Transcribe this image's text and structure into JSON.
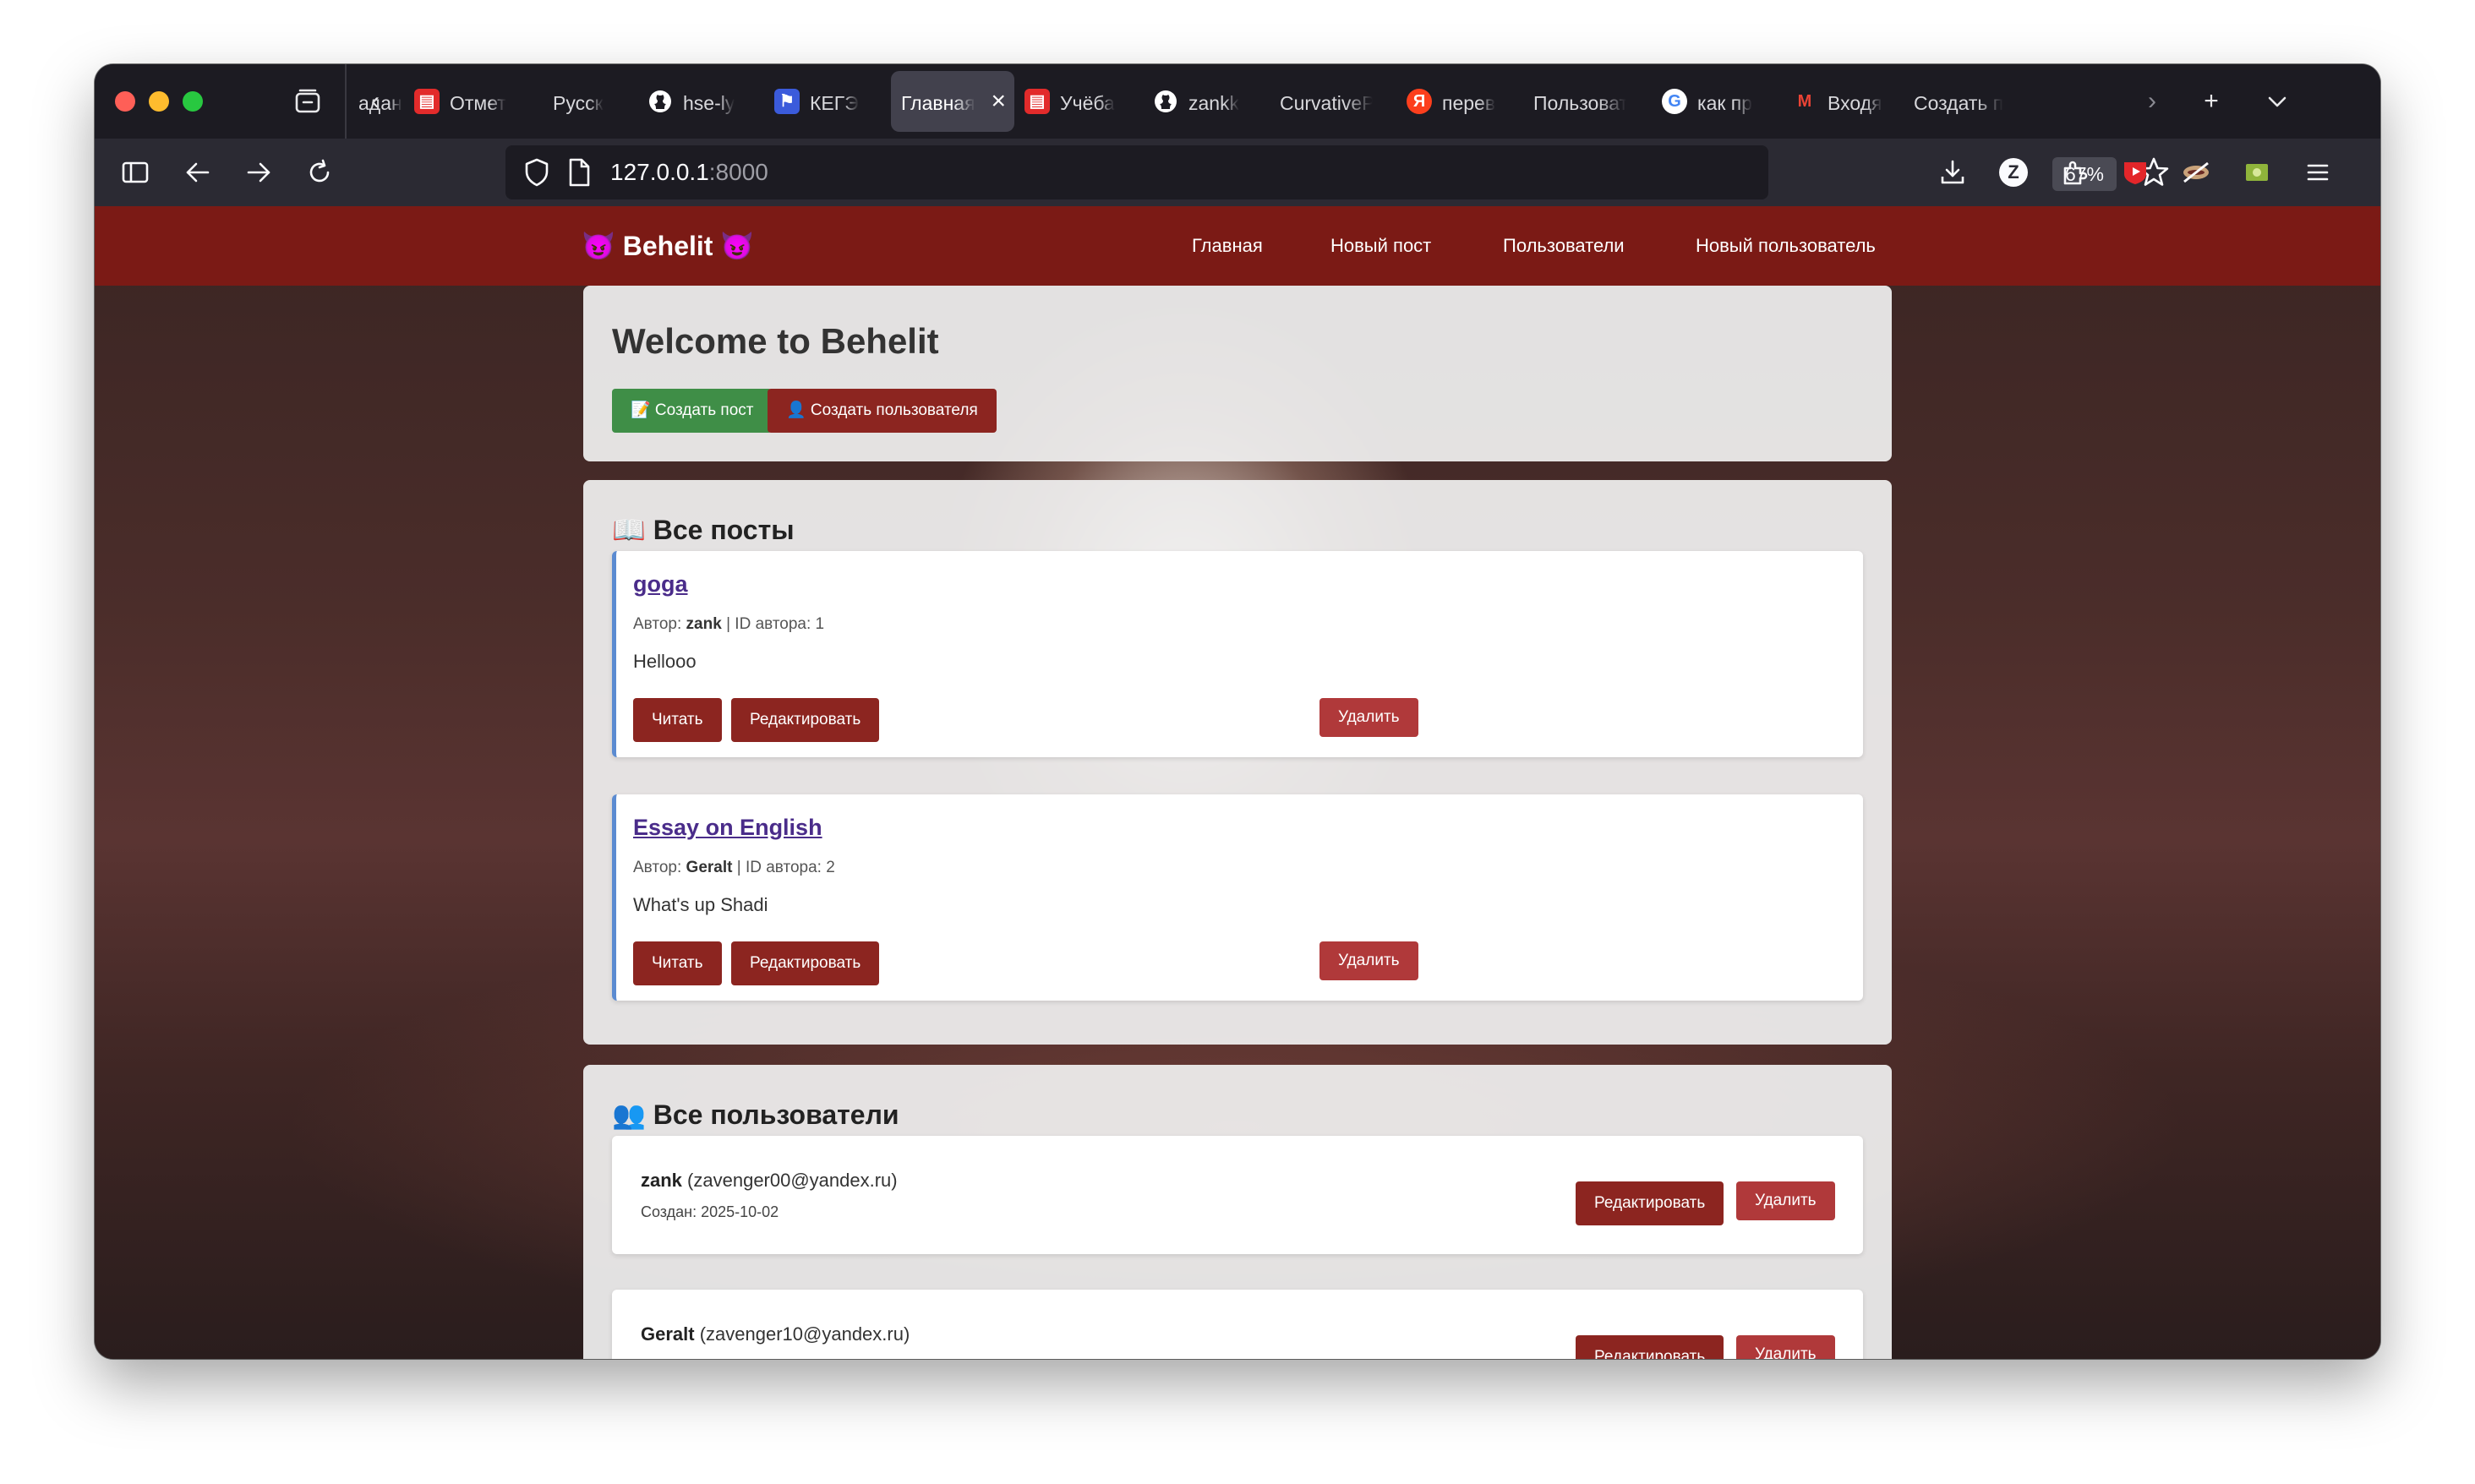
{
  "browser": {
    "tabs": [
      {
        "label": "адан",
        "favicon": "",
        "favicon_color": ""
      },
      {
        "label": "Отмет",
        "favicon": "doc-icon",
        "favicon_color": "#e22b2b"
      },
      {
        "label": "Русск",
        "favicon": "",
        "favicon_color": ""
      },
      {
        "label": "hse-ly",
        "favicon": "github-icon",
        "favicon_color": "#ffffff"
      },
      {
        "label": "КЕГЭ",
        "favicon": "kege-icon",
        "favicon_color": "#3b5bdb"
      },
      {
        "label": "Главная",
        "favicon": "",
        "favicon_color": "",
        "active": true
      },
      {
        "label": "Учёба",
        "favicon": "doc-icon",
        "favicon_color": "#e22b2b"
      },
      {
        "label": "zankk",
        "favicon": "github-icon",
        "favicon_color": "#ffffff"
      },
      {
        "label": "CurvativeP",
        "favicon": "",
        "favicon_color": ""
      },
      {
        "label": "перев",
        "favicon": "yandex-icon",
        "favicon_color": "#fc3f1d"
      },
      {
        "label": "Пользоват",
        "favicon": "",
        "favicon_color": ""
      },
      {
        "label": "как пр",
        "favicon": "google-icon",
        "favicon_color": "#4285f4"
      },
      {
        "label": "Входя",
        "favicon": "gmail-icon",
        "favicon_color": "#ea4335"
      },
      {
        "label": "Создать п",
        "favicon": "",
        "favicon_color": ""
      }
    ],
    "url_host": "127.0.0.1",
    "url_port": ":8000",
    "zoom": "67%"
  },
  "nav": {
    "brand": "😈 Behelit 😈",
    "links": [
      "Главная",
      "Новый пост",
      "Пользователи",
      "Новый пользователь"
    ]
  },
  "welcome": {
    "title": "Welcome to Behelit",
    "create_post": "📝 Создать пост",
    "create_user": "👤 Создать пользователя"
  },
  "posts_section": {
    "heading": "📖 Все посты",
    "posts": [
      {
        "title": "goga",
        "author_label": "Автор:",
        "author": "zank",
        "author_id_label": "| ID автора: 1",
        "body": "Hellooo"
      },
      {
        "title": "Essay on English",
        "author_label": "Автор:",
        "author": "Geralt",
        "author_id_label": "| ID автора: 2",
        "body": "What's up Shadi"
      }
    ],
    "read_label": "Читать",
    "edit_label": "Редактировать",
    "delete_label": "Удалить"
  },
  "users_section": {
    "heading": "👥 Все пользователи",
    "users": [
      {
        "name": "zank",
        "email": "(zavenger00@yandex.ru)",
        "created": "Создан: 2025-10-02"
      },
      {
        "name": "Geralt",
        "email": "(zavenger10@yandex.ru)",
        "created": ""
      }
    ],
    "edit_label": "Редактировать",
    "delete_label": "Удалить"
  },
  "colors": {
    "navbar": "#7b1a15",
    "primary_red": "#8c2520",
    "danger": "#b0393a",
    "success": "#3f8e47",
    "post_border": "#5b8bd1"
  }
}
